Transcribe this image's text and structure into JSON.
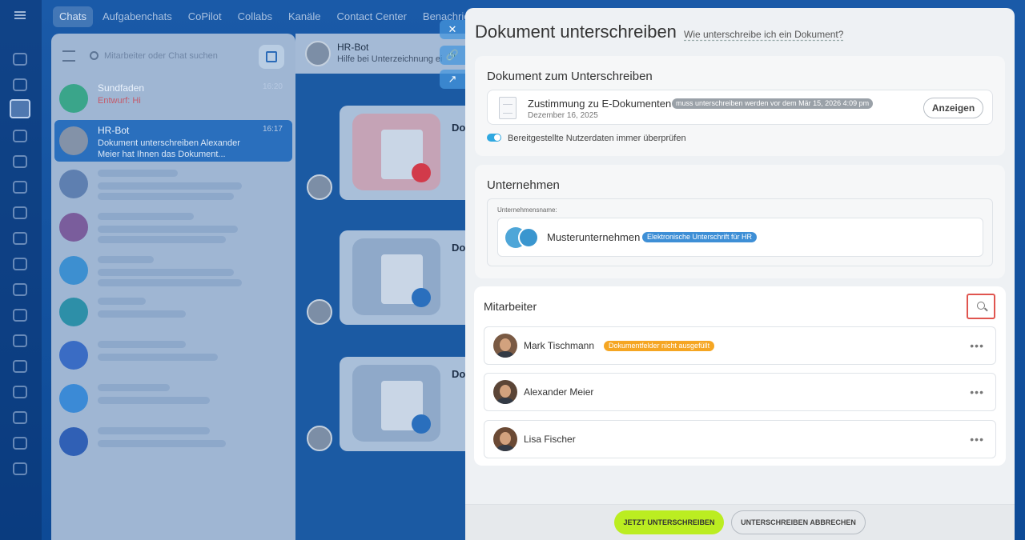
{
  "background": {
    "tabs": [
      "Chats",
      "Aufgabenchats",
      "CoPilot",
      "Collabs",
      "Kanäle",
      "Contact Center",
      "Benachrichtigungen"
    ],
    "search_placeholder": "Mitarbeiter oder Chat suchen",
    "chats": [
      {
        "name": "Sundfaden",
        "time": "16:20",
        "preview": "Entwurf: Hi"
      },
      {
        "name": "HR-Bot",
        "time": "16:17",
        "preview": "Dokument unterschreiben Alexander Meier hat Ihnen das Dokument..."
      }
    ],
    "bot": {
      "name": "HR-Bot",
      "subtitle": "Hilfe bei Unterzeichnung ei"
    },
    "message_titles": [
      "Do",
      "Do",
      "Do"
    ]
  },
  "panel": {
    "title": "Dokument unterschreiben",
    "help_link": "Wie unterschreibe ich ein Dokument?",
    "document_section": {
      "title": "Dokument zum Unterschreiben",
      "doc_name": "Zustimmung zu E-Dokumenten",
      "doc_tag": "muss unterschreiben werden vor dem Mär 15, 2026 4:09 pm",
      "doc_date": "Dezember 16, 2025",
      "show_button": "Anzeigen",
      "toggle_label": "Bereitgestellte Nutzerdaten immer überprüfen",
      "toggle_on": true
    },
    "company_section": {
      "title": "Unternehmen",
      "field_label": "Unternehmensname:",
      "company_name": "Musterunternehmen",
      "company_tag": "Elektronische Unterschrift für HR"
    },
    "employees_section": {
      "title": "Mitarbeiter",
      "employees": [
        {
          "name": "Mark Tischmann",
          "badge": "Dokumentfelder nicht ausgefüllt",
          "more": "•••"
        },
        {
          "name": "Alexander Meier",
          "badge": "",
          "more": "•••"
        },
        {
          "name": "Lisa Fischer",
          "badge": "",
          "more": "•••"
        }
      ]
    },
    "footer": {
      "sign_button": "JETZT UNTERSCHREIBEN",
      "cancel_button": "UNTERSCHREIBEN ABBRECHEN"
    }
  },
  "colors": {
    "accent_green": "#bbed21",
    "badge_orange": "#f5a623",
    "tag_blue": "#3e8fd6",
    "highlight_red": "#e0554f"
  }
}
